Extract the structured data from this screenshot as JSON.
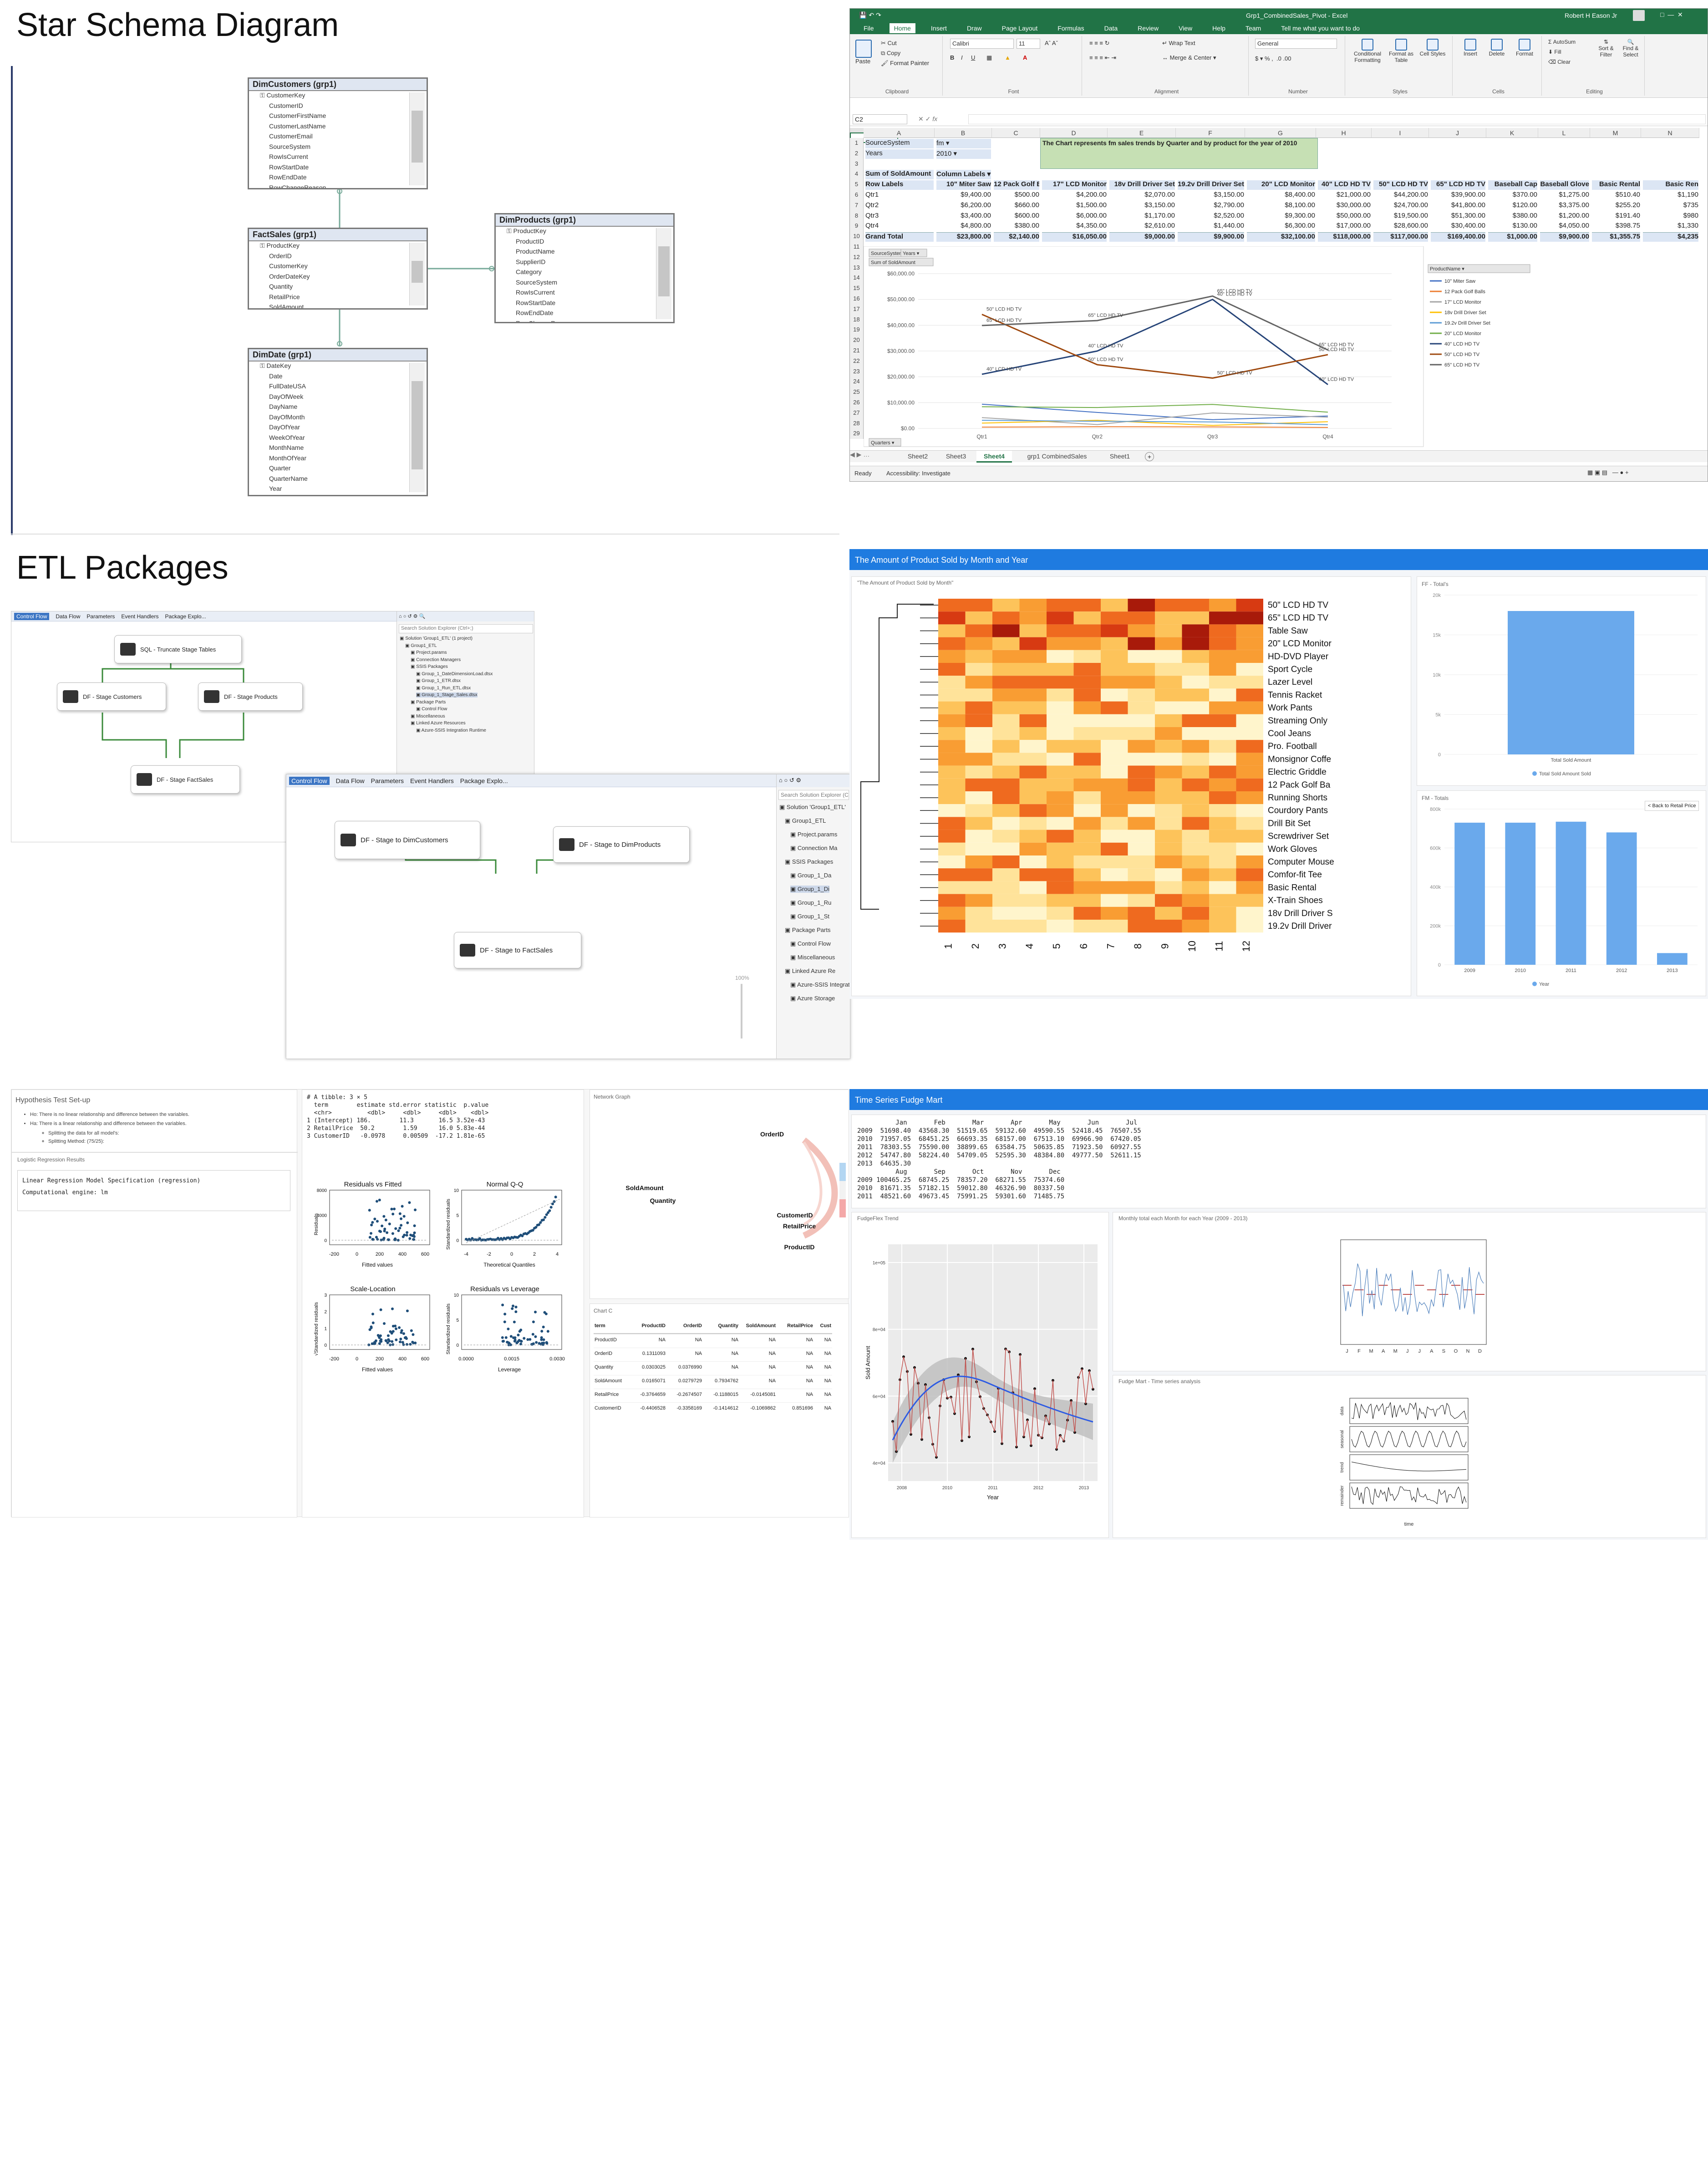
{
  "sections": {
    "star_title": "Star Schema Diagram",
    "etl_title": "ETL Packages"
  },
  "schema": {
    "dimcustomers": {
      "title": "DimCustomers (grp1)",
      "fields": [
        "CustomerKey",
        "CustomerID",
        "CustomerFirstName",
        "CustomerLastName",
        "CustomerEmail",
        "SourceSystem",
        "RowIsCurrent",
        "RowStartDate",
        "RowEndDate",
        "RowChangeReason"
      ]
    },
    "factsales": {
      "title": "FactSales (grp1)",
      "fields": [
        "ProductKey",
        "OrderID",
        "CustomerKey",
        "OrderDateKey",
        "Quantity",
        "RetailPrice",
        "SoldAmount"
      ]
    },
    "dimproducts": {
      "title": "DimProducts (grp1)",
      "fields": [
        "ProductKey",
        "ProductID",
        "ProductName",
        "SupplierID",
        "Category",
        "SourceSystem",
        "RowIsCurrent",
        "RowStartDate",
        "RowEndDate",
        "RowChangeReason"
      ]
    },
    "dimdate": {
      "title": "DimDate (grp1)",
      "fields": [
        "DateKey",
        "Date",
        "FullDateUSA",
        "DayOfWeek",
        "DayName",
        "DayOfMonth",
        "DayOfYear",
        "WeekOfYear",
        "MonthName",
        "MonthOfYear",
        "Quarter",
        "QuarterName",
        "Year"
      ]
    }
  },
  "excel": {
    "window_title": "Grp1_CombinedSales_Pivot - Excel",
    "user": "Robert H Eason Jr",
    "menu": [
      "File",
      "Home",
      "Insert",
      "Draw",
      "Page Layout",
      "Formulas",
      "Data",
      "Review",
      "View",
      "Help",
      "Team",
      "Tell me what you want to do"
    ],
    "ribbon": {
      "cut": "Cut",
      "copy": "Copy",
      "format_painter": "Format Painter",
      "paste": "Paste",
      "clipboard": "Clipboard",
      "font_name": "Calibri",
      "font_size": "11",
      "font": "Font",
      "wrap": "Wrap Text",
      "merge": "Merge & Center",
      "alignment": "Alignment",
      "number_format": "General",
      "number": "Number",
      "cond": "Conditional Formatting",
      "fmt_table": "Format as Table",
      "cell_styles": "Cell Styles",
      "styles": "Styles",
      "insert": "Insert",
      "delete": "Delete",
      "format": "Format",
      "cells": "Cells",
      "autosum": "AutoSum",
      "fill": "Fill",
      "clear": "Clear",
      "sort": "Sort & Filter",
      "find": "Find & Select",
      "editing": "Editing"
    },
    "namebox": "C2",
    "columns": [
      "A",
      "B",
      "C",
      "D",
      "E",
      "F",
      "G",
      "H",
      "I",
      "J",
      "K",
      "L",
      "M",
      "N"
    ],
    "filter_rows": [
      {
        "label": "SourceSystem",
        "value": "fm"
      },
      {
        "label": "Years",
        "value": "2010"
      }
    ],
    "note": "The Chart represents fm sales trends by Quarter and by product for the year of 2010",
    "pivot_header": {
      "a": "Sum of SoldAmount",
      "b": "Column Labels"
    },
    "pivot_cols": [
      "Row Labels",
      "10\" Miter Saw",
      "12 Pack Golf Balls",
      "17\" LCD Monitor",
      "18v Drill Driver Set",
      "19.2v Drill Driver Set",
      "20\" LCD Monitor",
      "40\" LCD HD TV",
      "50\" LCD HD TV",
      "65\" LCD HD TV",
      "Baseball Cap",
      "Baseball Glove",
      "Basic Rental",
      "Basic Ren"
    ],
    "pivot_rows": [
      [
        "Qtr1",
        "$9,400.00",
        "$500.00",
        "$4,200.00",
        "$2,070.00",
        "$3,150.00",
        "$8,400.00",
        "$21,000.00",
        "$44,200.00",
        "$39,900.00",
        "$370.00",
        "$1,275.00",
        "$510.40",
        "$1,190"
      ],
      [
        "Qtr2",
        "$6,200.00",
        "$660.00",
        "$1,500.00",
        "$3,150.00",
        "$2,790.00",
        "$8,100.00",
        "$30,000.00",
        "$24,700.00",
        "$41,800.00",
        "$120.00",
        "$3,375.00",
        "$255.20",
        "$735"
      ],
      [
        "Qtr3",
        "$3,400.00",
        "$600.00",
        "$6,000.00",
        "$1,170.00",
        "$2,520.00",
        "$9,300.00",
        "$50,000.00",
        "$19,500.00",
        "$51,300.00",
        "$380.00",
        "$1,200.00",
        "$191.40",
        "$980"
      ],
      [
        "Qtr4",
        "$4,800.00",
        "$380.00",
        "$4,350.00",
        "$2,610.00",
        "$1,440.00",
        "$6,300.00",
        "$17,000.00",
        "$28,600.00",
        "$30,400.00",
        "$130.00",
        "$4,050.00",
        "$398.75",
        "$1,330"
      ],
      [
        "Grand Total",
        "$23,800.00",
        "$2,140.00",
        "$16,050.00",
        "$9,000.00",
        "$9,900.00",
        "$32,100.00",
        "$118,000.00",
        "$117,000.00",
        "$169,400.00",
        "$1,000.00",
        "$9,900.00",
        "$1,355.75",
        "$4,235"
      ]
    ],
    "chart_buttons": [
      "SourceSystem",
      "Years",
      "Sum of SoldAmount",
      "Quarters"
    ],
    "sheet_tabs": [
      "Sheet2",
      "Sheet3",
      "Sheet4",
      "grp1 CombinedSales",
      "Sheet1"
    ],
    "active_sheet": "Sheet4",
    "status": "Ready",
    "accessibility": "Accessibility: Investigate"
  },
  "chart_data": [
    {
      "type": "line",
      "title": "",
      "categories": [
        "Qtr1",
        "Qtr2",
        "Qtr3",
        "Qtr4"
      ],
      "ylim": [
        0,
        60000
      ],
      "yticks": [
        "$0.00",
        "$10,000.00",
        "$20,000.00",
        "$30,000.00",
        "$40,000.00",
        "$50,000.00",
        "$60,000.00"
      ],
      "legend_title": "ProductName",
      "legend": "right",
      "series": [
        {
          "name": "10\" Miter Saw",
          "values": [
            9400,
            6200,
            3400,
            4800
          ]
        },
        {
          "name": "12 Pack Golf Balls",
          "values": [
            500,
            660,
            600,
            380
          ]
        },
        {
          "name": "17\" LCD Monitor",
          "values": [
            4200,
            1500,
            6000,
            4350
          ]
        },
        {
          "name": "18v Drill Driver Set",
          "values": [
            2070,
            3150,
            1170,
            2610
          ]
        },
        {
          "name": "19.2v Drill Driver Set",
          "values": [
            3150,
            2790,
            2520,
            1440
          ]
        },
        {
          "name": "20\" LCD Monitor",
          "values": [
            8400,
            8100,
            9300,
            6300
          ]
        },
        {
          "name": "40\" LCD HD TV",
          "values": [
            21000,
            30000,
            50000,
            17000
          ]
        },
        {
          "name": "50\" LCD HD TV",
          "values": [
            44200,
            24700,
            19500,
            28600
          ]
        },
        {
          "name": "65\" LCD HD TV",
          "values": [
            39900,
            41800,
            51300,
            30400
          ]
        }
      ],
      "point_labels": [
        "65\" LCD HD TV",
        "50\" LCD HD TV",
        "40\" LCD HD TV"
      ]
    },
    {
      "type": "bar",
      "title": "FF - Total's",
      "categories": [
        "Total Sold Amount"
      ],
      "values": [
        18000
      ],
      "yticks": [
        "0",
        "5k",
        "10k",
        "15k",
        "20k"
      ],
      "legend": "Total Sold Amount Sold"
    },
    {
      "type": "bar",
      "title": "FM - Totals",
      "categories": [
        "2009",
        "2010",
        "2011",
        "2012",
        "2013"
      ],
      "values": [
        730000,
        730000,
        735000,
        680000,
        60000
      ],
      "yticks": [
        "0",
        "200k",
        "400k",
        "600k",
        "800k"
      ],
      "legend": "Year"
    }
  ],
  "ssis1": {
    "tabs": [
      "Control Flow",
      "Data Flow",
      "Parameters",
      "Event Handlers",
      "Package Explo..."
    ],
    "tasks": [
      "SQL - Truncate Stage Tables",
      "DF - Stage Customers",
      "DF - Stage Products",
      "DF - Stage FactSales"
    ],
    "search": "Search Solution Explorer (Ctrl+;)",
    "tree": [
      "Solution 'Group1_ETL' (1 project)",
      "Group1_ETL",
      "Project.params",
      "Connection Managers",
      "SSIS Packages",
      "Group_1_DateDimensionLoad.dtsx",
      "Group_1_ETR.dtsx",
      "Group_1_Run_ETL.dtsx",
      "Group_1_Stage_Sales.dtsx",
      "Package Parts",
      "Control Flow",
      "Miscellaneous",
      "Linked Azure Resources",
      "Azure-SSIS Integration Runtime"
    ]
  },
  "ssis2": {
    "tabs": [
      "Control Flow",
      "Data Flow",
      "Parameters",
      "Event Handlers",
      "Package Explo..."
    ],
    "tasks": [
      "DF - Stage to DimCustomers",
      "DF - Stage to DimProducts",
      "DF - Stage to FactSales"
    ],
    "zoom": "100%",
    "search": "Search Solution Explorer (C",
    "tree": [
      "Solution 'Group1_ETL'",
      "Group1_ETL",
      "Project.params",
      "Connection Ma",
      "SSIS Packages",
      "Group_1_Da",
      "Group_1_Di",
      "Group_1_Ru",
      "Group_1_St",
      "Package Parts",
      "Control Flow",
      "Miscellaneous",
      "Linked Azure Re",
      "Azure-SSIS Integration Runtime",
      "Azure Storage"
    ]
  },
  "heatmap": {
    "header": "The Amount of Product Sold by Month and Year",
    "caption": "\"The Amount of Product Sold by Month\"",
    "products": [
      "50\" LCD HD TV",
      "65\" LCD HD TV",
      "Table Saw",
      "20\" LCD Monitor",
      "HD-DVD Player",
      "Sport Cycle",
      "Lazer Level",
      "Tennis Racket",
      "Work Pants",
      "Streaming Only",
      "Cool Jeans",
      "Pro. Football",
      "Monsignor Coffe",
      "Electric Griddle",
      "12 Pack Golf Ba",
      "Running Shorts",
      "Courdory Pants",
      "Drill Bit Set",
      "Screwdriver Set",
      "Work Gloves",
      "Computer Mouse",
      "Comfor-fit Tee",
      "Basic Rental",
      "X-Train Shoes",
      "18v Drill Driver S",
      "19.2v Drill Driver"
    ],
    "months": [
      "1",
      "2",
      "3",
      "4",
      "5",
      "6",
      "7",
      "8",
      "9",
      "10",
      "11",
      "12"
    ],
    "back_button": "< Back to Retail Price"
  },
  "hypothesis": {
    "title": "Hypothesis Test Set-up",
    "h0": "Ho: There is no linear relationship and difference between the variables.",
    "ha": "Ha: There is a linear relationship and difference between the variables.",
    "split1": "Splitting the data for all model's:",
    "split2": "Splitting Method: (75/25):",
    "results_title": "Logistic Regression Results",
    "spec": "Linear Regression Model Specification (regression)",
    "engine": "Computational engine: lm"
  },
  "tibble": {
    "lines": [
      "# A tibble: 3 × 5",
      "  term        estimate std.error statistic  p.value",
      "  <chr>          <dbl>     <dbl>     <dbl>    <dbl>",
      "1 (Intercept) 186.        11.3       16.5 3.52e-43",
      "2 RetailPrice  50.2        1.59      16.0 5.83e-44",
      "3 CustomerID   -0.0978     0.00509  -17.2 1.81e-65"
    ]
  },
  "diag_plots": [
    {
      "title": "Residuals vs Fitted",
      "xlabel": "Fitted values",
      "ylabel": "Residuals",
      "xticks": [
        "-200",
        "0",
        "200",
        "400",
        "600"
      ],
      "yticks": [
        "0",
        "4000",
        "8000"
      ]
    },
    {
      "title": "Normal Q-Q",
      "xlabel": "Theoretical Quantiles",
      "ylabel": "Standardized residuals",
      "xticks": [
        "-4",
        "-2",
        "0",
        "2",
        "4"
      ],
      "yticks": [
        "0",
        "5",
        "10"
      ]
    },
    {
      "title": "Scale-Location",
      "xlabel": "Fitted values",
      "ylabel": "√Standardized residuals",
      "xticks": [
        "-200",
        "0",
        "200",
        "400",
        "600"
      ],
      "yticks": [
        "0",
        "1",
        "2",
        "3"
      ]
    },
    {
      "title": "Residuals vs Leverage",
      "xlabel": "Leverage",
      "ylabel": "Standardized residuals",
      "xticks": [
        "0.0000",
        "0.0015",
        "0.0030"
      ],
      "yticks": [
        "0",
        "5",
        "10"
      ]
    }
  ],
  "network": {
    "title": "Network Graph",
    "nodes": [
      "OrderID",
      "SoldAmount",
      "Quantity",
      "CustomerID",
      "RetailPrice",
      "ProductID"
    ]
  },
  "corr": {
    "title": "Chart C",
    "headers": [
      "term",
      "ProductID",
      "OrderID",
      "Quantity",
      "SoldAmount",
      "RetailPrice",
      "Cust"
    ],
    "rows": [
      [
        "ProductID",
        "NA",
        "NA",
        "NA",
        "NA",
        "NA",
        "NA"
      ],
      [
        "OrderID",
        "0.1311093",
        "NA",
        "NA",
        "NA",
        "NA",
        "NA"
      ],
      [
        "Quantity",
        "0.0303025",
        "0.0376990",
        "NA",
        "NA",
        "NA",
        "NA"
      ],
      [
        "SoldAmount",
        "0.0165071",
        "0.0279729",
        "0.7934762",
        "NA",
        "NA",
        "NA"
      ],
      [
        "RetailPrice",
        "-0.3764659",
        "-0.2674507",
        "-0.1188015",
        "-0.0145081",
        "NA",
        "NA"
      ],
      [
        "CustomerID",
        "-0.4406528",
        "-0.3358169",
        "-0.1414612",
        "-0.1069862",
        "0.851696",
        "NA"
      ]
    ]
  },
  "fudge": {
    "header": "Time Series Fudge Mart",
    "ts_lines": [
      "          Jan       Feb       Mar       Apr       May       Jun       Jul",
      "2009  51698.40  43568.30  51519.65  59132.60  49590.55  52418.45  76507.55",
      "2010  71957.05  68451.25  66693.35  68157.00  67513.10  69966.90  67420.05",
      "2011  78303.55  75590.00  38899.65  63584.75  50635.85  71923.50  60927.55",
      "2012  54747.80  58224.40  54709.05  52595.30  48384.80  49777.50  52611.15",
      "2013  64635.30",
      "          Aug       Sep       Oct       Nov       Dec",
      "2009 100465.25  68745.25  78357.20  68271.55  75374.60",
      "2010  81671.35  57182.15  59012.80  46326.90  80337.50",
      "2011  48521.60  49673.45  75991.25  59301.60  71485.75"
    ],
    "trend_title": "FudgeFlex Trend",
    "trend_xlabel": "Year",
    "trend_ylabel": "Sold Amount",
    "trend_xticks": [
      "2008",
      "2010",
      "2011",
      "2012",
      "2013"
    ],
    "trend_yticks": [
      "4e+04",
      "6e+04",
      "8e+04",
      "1e+05"
    ],
    "monthly_title": "Monthly total each Month for each Year (2009 - 2013)",
    "monthly_xticks": [
      "J",
      "F",
      "M",
      "A",
      "M",
      "J",
      "J",
      "A",
      "S",
      "O",
      "N",
      "D"
    ],
    "decomp_title": "Fudge Mart - Time series analysis",
    "decomp_labels": [
      "data",
      "seasonal",
      "trend",
      "remainder"
    ],
    "decomp_xlabel": "time"
  }
}
